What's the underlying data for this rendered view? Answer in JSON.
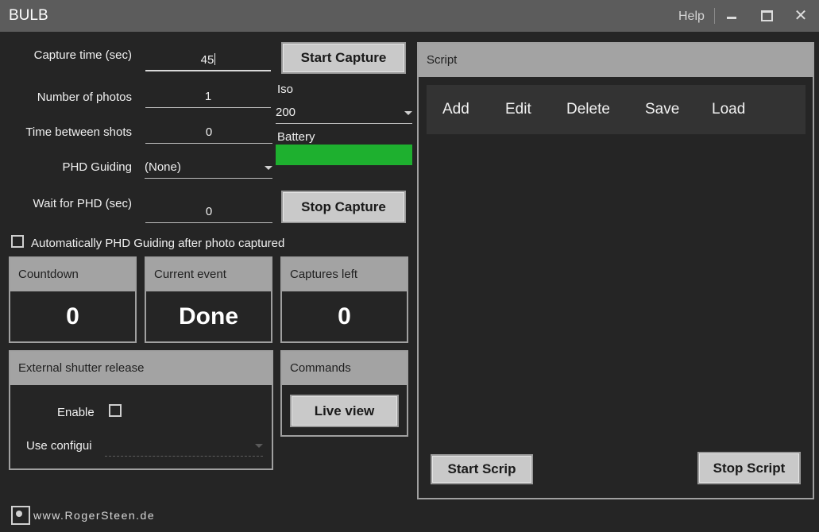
{
  "window": {
    "title": "BULB",
    "help_label": "Help",
    "minimize_icon": "minimize-icon",
    "maximize_icon": "maximize-icon",
    "close_icon": "close-icon",
    "close_glyph": "✕"
  },
  "settings": {
    "capture_time_label": "Capture time (sec)",
    "capture_time_value": "45",
    "num_photos_label": "Number of photos",
    "num_photos_value": "1",
    "time_between_label": "Time between shots",
    "time_between_value": "0",
    "phd_guiding_label": "PHD Guiding",
    "phd_guiding_value": "(None)",
    "wait_phd_label": "Wait for PHD (sec)",
    "wait_phd_value": "0",
    "auto_phd_label": "Automatically PHD Guiding after photo captured",
    "auto_phd_checked": false
  },
  "camera": {
    "start_capture_label": "Start Capture",
    "iso_label": "Iso",
    "iso_value": "200",
    "battery_label": "Battery",
    "battery_level": 1.0,
    "battery_color": "#1eb02f",
    "stop_capture_label": "Stop Capture"
  },
  "status": {
    "countdown_label": "Countdown",
    "countdown_value": "0",
    "current_event_label": "Current event",
    "current_event_value": "Done",
    "captures_left_label": "Captures left",
    "captures_left_value": "0"
  },
  "external_shutter": {
    "title": "External shutter release",
    "enable_label": "Enable",
    "enable_checked": false,
    "use_config_label": "Use configui"
  },
  "commands": {
    "title": "Commands",
    "live_view_label": "Live view"
  },
  "script": {
    "title": "Script",
    "toolbar": [
      "Add",
      "Edit",
      "Delete",
      "Save",
      "Load"
    ],
    "start_script_label": "Start Scrip",
    "stop_script_label": "Stop Script"
  },
  "footer": {
    "website": "www.RogerSteen.de",
    "logo_icon": "camera-logo-icon"
  },
  "colors": {
    "background": "#252525",
    "titlebar": "#5c5c5c",
    "panel_header": "#a3a3a3",
    "button": "#c9c9c9"
  }
}
